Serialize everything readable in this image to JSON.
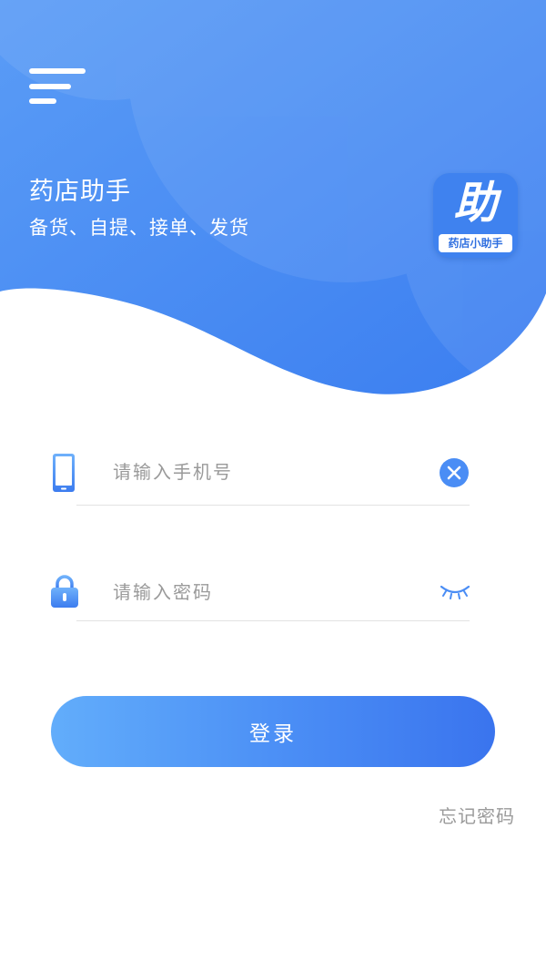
{
  "header": {
    "menu_icon": "hamburger-menu-icon",
    "app_title": "药店助手",
    "app_subtitle": "备货、自提、接单、发货",
    "logo": {
      "char": "助",
      "caption": "药店小助手"
    }
  },
  "form": {
    "phone": {
      "icon": "phone-icon",
      "placeholder": "请输入手机号",
      "value": "",
      "clear_icon": "clear-icon"
    },
    "password": {
      "icon": "lock-icon",
      "placeholder": "请输入密码",
      "value": "",
      "toggle_icon": "eye-closed-icon"
    },
    "login_label": "登录",
    "forgot_label": "忘记密码"
  },
  "colors": {
    "primary": "#4a8df5",
    "gradient_start": "#62adfb",
    "gradient_end": "#3a74ee",
    "placeholder": "#9a9a9a"
  }
}
